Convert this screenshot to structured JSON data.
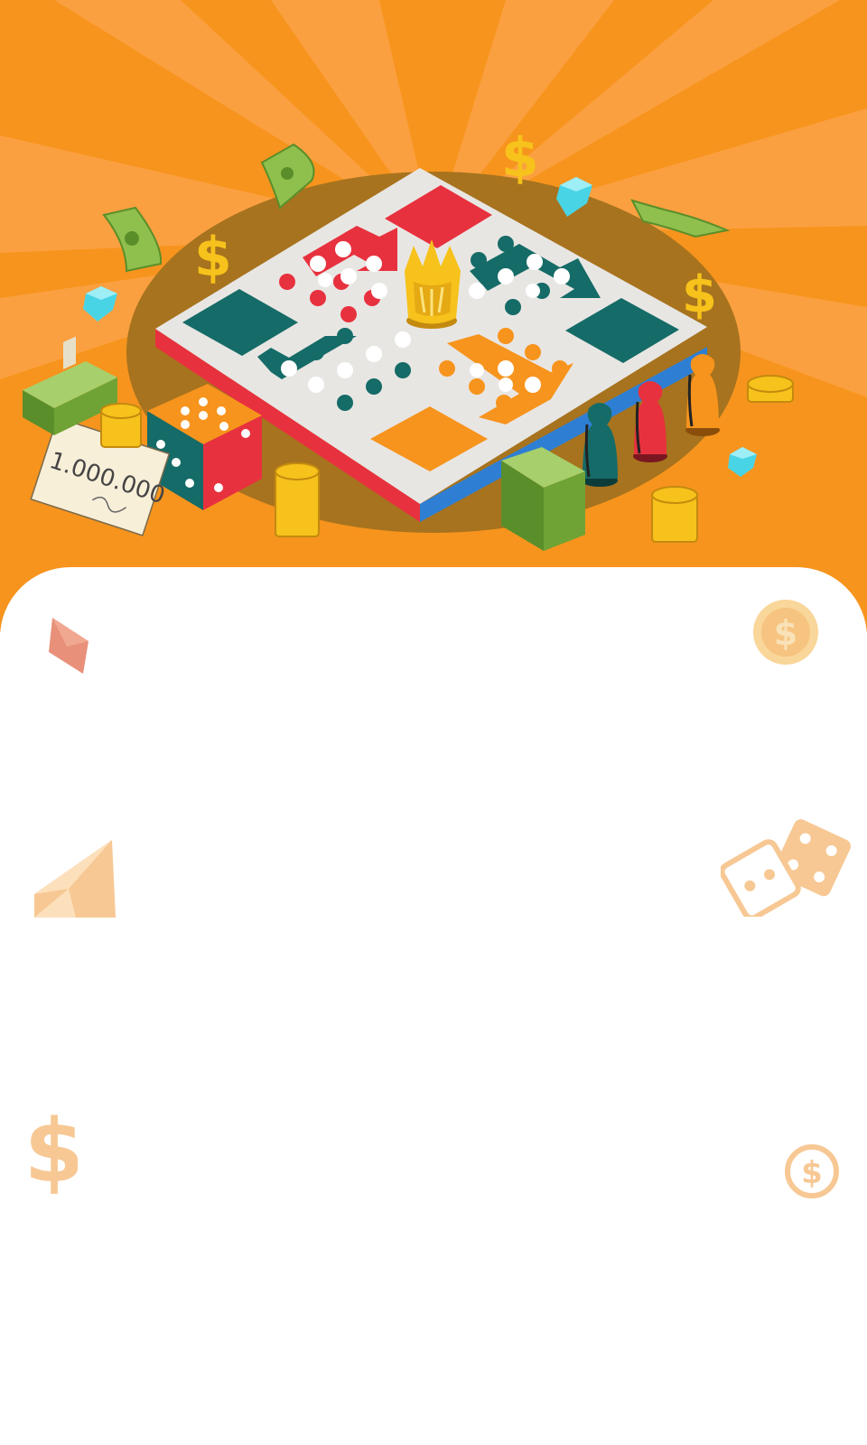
{
  "scene": {
    "type": "ludo-board-game-hero",
    "cheque_amount": "1.000.000",
    "icons": [
      "dollar-icon",
      "gem-icon",
      "banknote-icon",
      "money-stack-icon",
      "coin-stack-icon",
      "dice-icon",
      "crown-icon",
      "pawn-icon",
      "cheque-icon"
    ]
  },
  "colors": {
    "background_orange": "#F7941D",
    "ray_orange": "#FBA040",
    "board_white": "#E8E6E3",
    "ludo_red": "#E8313E",
    "ludo_teal": "#156B67",
    "ludo_orange": "#F7941D",
    "board_edge_blue": "#2E7FD4",
    "gold": "#F6C21B",
    "gem_cyan": "#49D4E6",
    "cash_green": "#7DB33A",
    "deco_peach": "#F7C894"
  }
}
